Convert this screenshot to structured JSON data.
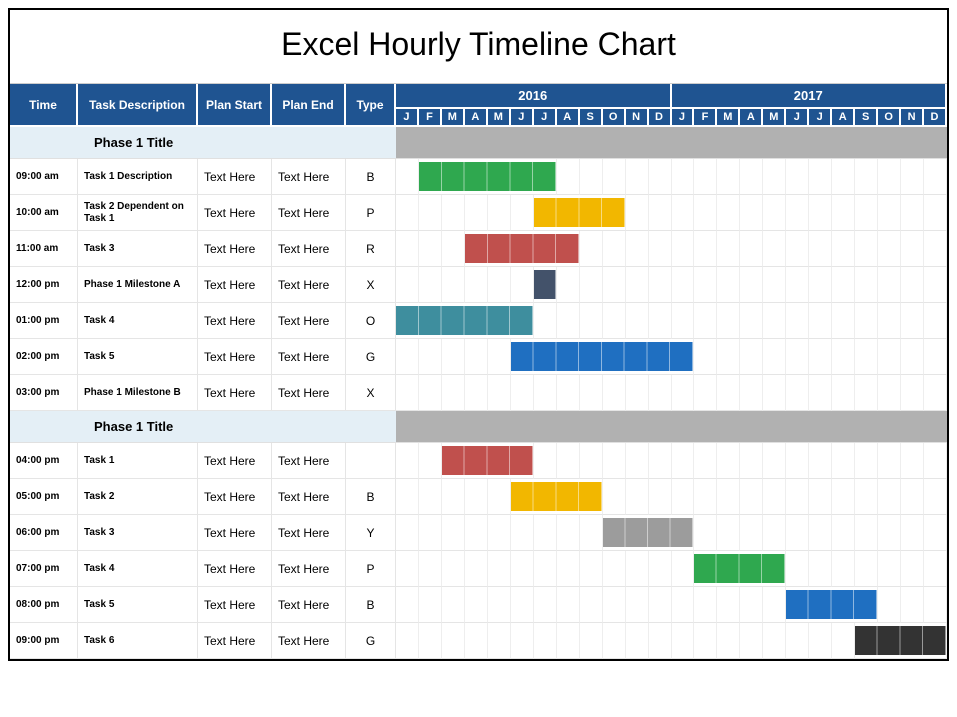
{
  "title": "Excel Hourly Timeline Chart",
  "headers": {
    "time": "Time",
    "desc": "Task Description",
    "pstart": "Plan Start",
    "pend": "Plan End",
    "type": "Type"
  },
  "years": [
    "2016",
    "2017"
  ],
  "months": [
    "J",
    "F",
    "M",
    "A",
    "M",
    "J",
    "J",
    "A",
    "S",
    "O",
    "N",
    "D"
  ],
  "chart_data": {
    "type": "gantt",
    "x_axis_months": [
      "2016-01",
      "2016-02",
      "2016-03",
      "2016-04",
      "2016-05",
      "2016-06",
      "2016-07",
      "2016-08",
      "2016-09",
      "2016-10",
      "2016-11",
      "2016-12",
      "2017-01",
      "2017-02",
      "2017-03",
      "2017-04",
      "2017-05",
      "2017-06",
      "2017-07",
      "2017-08",
      "2017-09",
      "2017-10",
      "2017-11",
      "2017-12"
    ],
    "phases": [
      {
        "label": "Phase 1 Title",
        "bar_start": 1,
        "bar_span": 24,
        "rows": [
          {
            "time": "09:00 am",
            "desc": "Task 1 Description",
            "pstart": "Text Here",
            "pend": "Text Here",
            "type": "B",
            "bar": {
              "start": 2,
              "span": 6,
              "color": "#2fa84f"
            }
          },
          {
            "time": "10:00 am",
            "desc": "Task 2 Dependent on Task 1",
            "pstart": "Text Here",
            "pend": "Text Here",
            "type": "P",
            "bar": {
              "start": 7,
              "span": 4,
              "color": "#f2b700"
            }
          },
          {
            "time": "11:00 am",
            "desc": "Task 3",
            "pstart": "Text Here",
            "pend": "Text Here",
            "type": "R",
            "bar": {
              "start": 4,
              "span": 5,
              "color": "#c0504d"
            }
          },
          {
            "time": "12:00 pm",
            "desc": "Phase 1 Milestone A",
            "pstart": "Text Here",
            "pend": "Text Here",
            "type": "X",
            "bar": {
              "start": 7,
              "span": 1,
              "color": "#43526a"
            }
          },
          {
            "time": "01:00 pm",
            "desc": "Task 4",
            "pstart": "Text Here",
            "pend": "Text Here",
            "type": "O",
            "bar": {
              "start": 1,
              "span": 6,
              "color": "#3e8e9e"
            }
          },
          {
            "time": "02:00 pm",
            "desc": "Task 5",
            "pstart": "Text Here",
            "pend": "Text Here",
            "type": "G",
            "bar": {
              "start": 6,
              "span": 8,
              "color": "#1f6fc1"
            }
          },
          {
            "time": "03:00 pm",
            "desc": "Phase 1 Milestone B",
            "pstart": "Text Here",
            "pend": "Text Here",
            "type": "X",
            "bar": null
          }
        ]
      },
      {
        "label": "Phase 1 Title",
        "bar_start": 1,
        "bar_span": 24,
        "rows": [
          {
            "time": "04:00 pm",
            "desc": "Task 1",
            "pstart": "Text Here",
            "pend": "Text Here",
            "type": "",
            "bar": {
              "start": 3,
              "span": 4,
              "color": "#c0504d"
            }
          },
          {
            "time": "05:00 pm",
            "desc": "Task 2",
            "pstart": "Text Here",
            "pend": "Text Here",
            "type": "B",
            "bar": {
              "start": 6,
              "span": 4,
              "color": "#f2b700"
            }
          },
          {
            "time": "06:00 pm",
            "desc": "Task 3",
            "pstart": "Text Here",
            "pend": "Text Here",
            "type": "Y",
            "bar": {
              "start": 10,
              "span": 4,
              "color": "#9c9c9c"
            }
          },
          {
            "time": "07:00 pm",
            "desc": "Task 4",
            "pstart": "Text Here",
            "pend": "Text Here",
            "type": "P",
            "bar": {
              "start": 14,
              "span": 4,
              "color": "#2fa84f"
            }
          },
          {
            "time": "08:00 pm",
            "desc": "Task 5",
            "pstart": "Text Here",
            "pend": "Text Here",
            "type": "B",
            "bar": {
              "start": 18,
              "span": 4,
              "color": "#1f6fc1"
            }
          },
          {
            "time": "09:00 pm",
            "desc": "Task 6",
            "pstart": "Text Here",
            "pend": "Text Here",
            "type": "G",
            "bar": {
              "start": 21,
              "span": 4,
              "color": "#333333"
            }
          }
        ]
      }
    ]
  }
}
